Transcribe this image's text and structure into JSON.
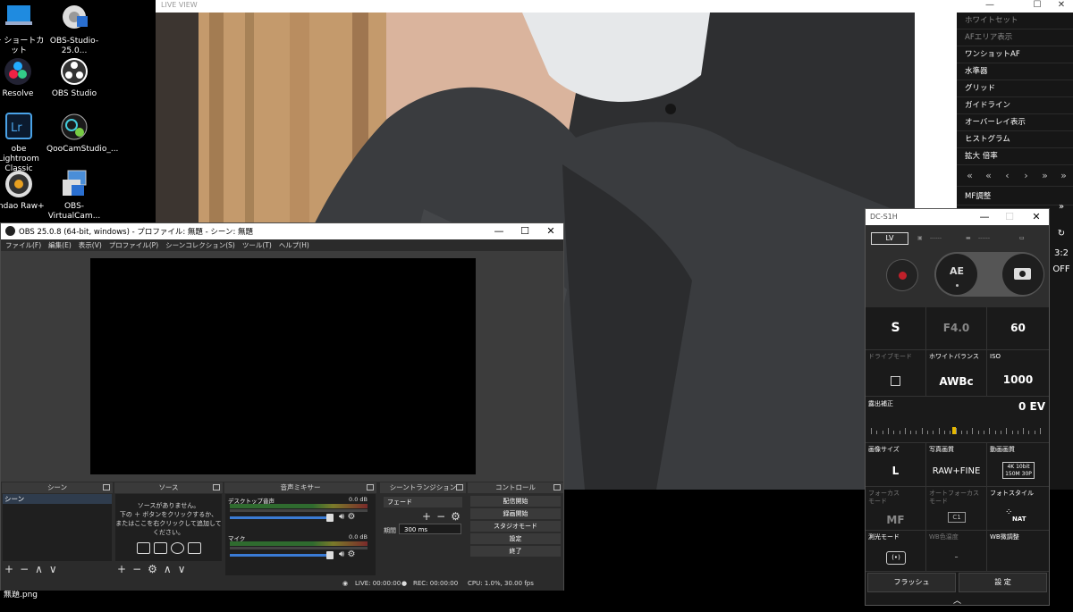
{
  "desktop": {
    "icons": [
      {
        "label": "ー ショートカット",
        "icon": "pc-shortcut-icon"
      },
      {
        "label": "OBS-Studio-25.0...",
        "icon": "installer-icon"
      },
      {
        "label": "Resolve",
        "icon": "davinci-resolve-icon"
      },
      {
        "label": "OBS Studio",
        "icon": "obs-icon"
      },
      {
        "label": "obe Lightroom Classic",
        "icon": "lightroom-icon"
      },
      {
        "label": "QooCamStudio_...",
        "icon": "qoocam-icon"
      },
      {
        "label": "andao Raw+",
        "icon": "raw-plus-icon"
      },
      {
        "label": "OBS-VirtualCam...",
        "icon": "virtualcam-installer-icon"
      }
    ],
    "file_caption": "無題.png"
  },
  "liveview": {
    "title": "LIVE VIEW",
    "menu": [
      "ホワイトセット",
      "AFエリア表示",
      "ワンショットAF",
      "水準器",
      "グリッド",
      "ガイドライン",
      "オーバーレイ表示",
      "ヒストグラム",
      "拡大 倍率"
    ],
    "nav": [
      "«",
      "«",
      "‹",
      "›",
      "»",
      "»"
    ],
    "mf_label": "MF調整",
    "right_values": [
      "»",
      "↻",
      "3:2",
      "OFF"
    ]
  },
  "obs": {
    "title": "OBS 25.0.8 (64-bit, windows) - プロファイル: 無題 - シーン: 無題",
    "menu": [
      "ファイル(F)",
      "編集(E)",
      "表示(V)",
      "プロファイル(P)",
      "シーンコレクション(S)",
      "ツール(T)",
      "ヘルプ(H)"
    ],
    "docks": {
      "scenes": {
        "title": "シーン",
        "items": [
          "シーン"
        ]
      },
      "sources": {
        "title": "ソース",
        "empty_text": "ソースがありません。\n下の ＋ ボタンをクリックするか、\nまたはここを右クリックして追加してください。"
      },
      "mixer": {
        "title": "音声ミキサー",
        "channels": [
          {
            "name": "デスクトップ音声",
            "db": "0.0 dB"
          },
          {
            "name": "マイク",
            "db": "0.0 dB"
          }
        ]
      },
      "transitions": {
        "title": "シーントランジション",
        "selected": "フェード",
        "duration_label": "期間",
        "duration": "300 ms"
      },
      "controls": {
        "title": "コントロール",
        "buttons": [
          "配信開始",
          "録画開始",
          "スタジオモード",
          "設定",
          "終了"
        ]
      }
    },
    "status": {
      "live": "LIVE: 00:00:00",
      "rec": "REC: 00:00:00",
      "cpu": "CPU: 1.0%, 30.00 fps"
    }
  },
  "camera": {
    "title": "DC-S1H",
    "lv_label": "LV",
    "ae_label": "AE",
    "indicators": [
      "------",
      "------",
      "------"
    ],
    "exposure_mode": "S",
    "aperture": "F4.0",
    "shutter": "60",
    "settings": [
      {
        "label": "ドライブモード",
        "value": "□",
        "dim_label": true
      },
      {
        "label": "ホワイトバランス",
        "value": "AWBc",
        "dim_label": false
      },
      {
        "label": "ISO",
        "value": "1000",
        "dim_label": false
      }
    ],
    "exposure_comp_label": "露出補正",
    "exposure_comp_value": "0 EV",
    "settings2": [
      {
        "label": "画像サイズ",
        "value": "L",
        "dim_label": false
      },
      {
        "label": "写真画質",
        "value": "RAW+FINE",
        "dim_label": false
      },
      {
        "label": "動画画質",
        "value": "4K 10bit 150M 30P",
        "dim_label": false
      },
      {
        "label": "フォーカス\nモード",
        "value": "MF",
        "dim_label": true
      },
      {
        "label": "オートフォーカス\nモード",
        "value": "C1",
        "dim_label": true
      },
      {
        "label": "フォトスタイル",
        "value": "NAT",
        "dim_label": false
      },
      {
        "label": "測光モード",
        "value": "(•)",
        "dim_label": false
      },
      {
        "label": "WB色温度",
        "value": "-",
        "dim_label": true
      },
      {
        "label": "WB微調整",
        "value": "",
        "dim_label": false
      }
    ],
    "buttons": [
      "フラッシュ",
      "設 定"
    ],
    "chevron": "︿"
  },
  "colors": {
    "record": "#c0202a",
    "ev_marker": "#e6b800",
    "slider": "#3a7bd5"
  }
}
